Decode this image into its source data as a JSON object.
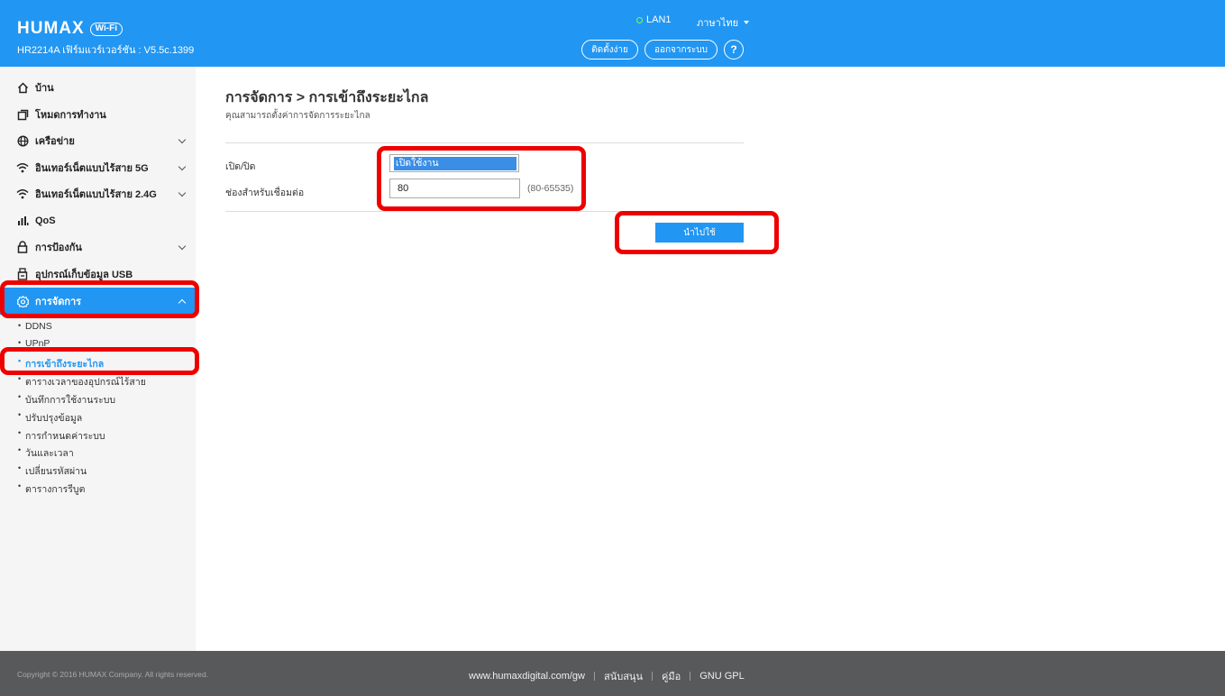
{
  "header": {
    "brand": "HUMAX",
    "wifi_badge": "Wi-Fi",
    "firmware": "HR2214A เฟิร์มแวร์เวอร์ชัน : V5.5c.1399",
    "lan_status": "LAN1",
    "language": "ภาษาไทย",
    "setup_label": "ติดตั้งง่าย",
    "logout_label": "ออกจากระบบ",
    "help_label": "?"
  },
  "sidebar": {
    "items": [
      {
        "label": "บ้าน",
        "icon": "home-icon"
      },
      {
        "label": "โหมดการทำงาน",
        "icon": "mode-icon"
      },
      {
        "label": "เครือข่าย",
        "icon": "globe-icon"
      },
      {
        "label": "อินเทอร์เน็ตแบบไร้สาย 5G",
        "icon": "wifi-icon"
      },
      {
        "label": "อินเทอร์เน็ตแบบไร้สาย 2.4G",
        "icon": "wifi-icon"
      },
      {
        "label": "QoS",
        "icon": "bars-icon"
      },
      {
        "label": "การป้องกัน",
        "icon": "lock-icon"
      },
      {
        "label": "อุปกรณ์เก็บข้อมูล USB",
        "icon": "usb-icon"
      },
      {
        "label": "การจัดการ",
        "icon": "gear-icon"
      }
    ],
    "sub_items": [
      "DDNS",
      "UPnP",
      "การเข้าถึงระยะไกล",
      "ตารางเวลาของอุปกรณ์ไร้สาย",
      "บันทึกการใช้งานระบบ",
      "ปรับปรุงข้อมูล",
      "การกำหนดค่าระบบ",
      "วันและเวลา",
      "เปลี่ยนรหัสผ่าน",
      "ตารางการรีบูต"
    ]
  },
  "main": {
    "title": "การจัดการ > การเข้าถึงระยะไกล",
    "subtitle": "คุณสามารถตั้งค่าการจัดการระยะไกล",
    "enable_label": "เปิด/ปิด",
    "enable_value": "เปิดใช้งาน",
    "port_label": "ช่องสำหรับเชื่อมต่อ",
    "port_value": "80",
    "port_range": "(80-65535)",
    "apply_label": "นำไปใช้"
  },
  "footer": {
    "copyright": "Copyright © 2016 HUMAX Company. All rights reserved.",
    "site": "www.humaxdigital.com/gw",
    "support": "สนับสนุน",
    "manual": "คู่มือ",
    "gpl": "GNU GPL"
  },
  "colors": {
    "header_bg": "#2196f3",
    "accent": "#2196f3",
    "highlight": "#ee0000",
    "footer_bg": "#58595b"
  }
}
